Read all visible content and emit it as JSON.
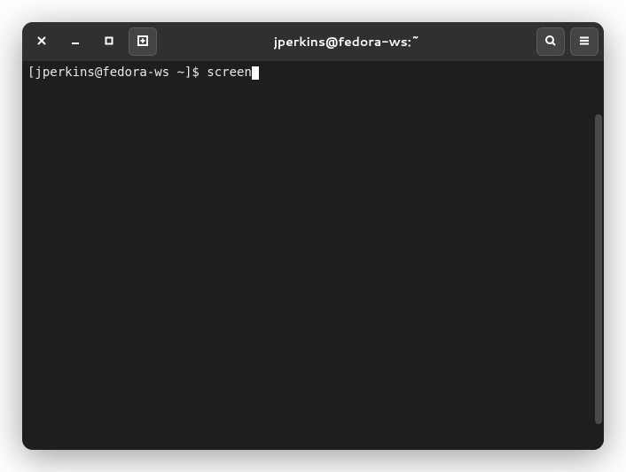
{
  "titlebar": {
    "title": "jperkins@fedora-ws:~"
  },
  "terminal": {
    "prompt": "[jperkins@fedora-ws ~]$ ",
    "command": "screen"
  }
}
